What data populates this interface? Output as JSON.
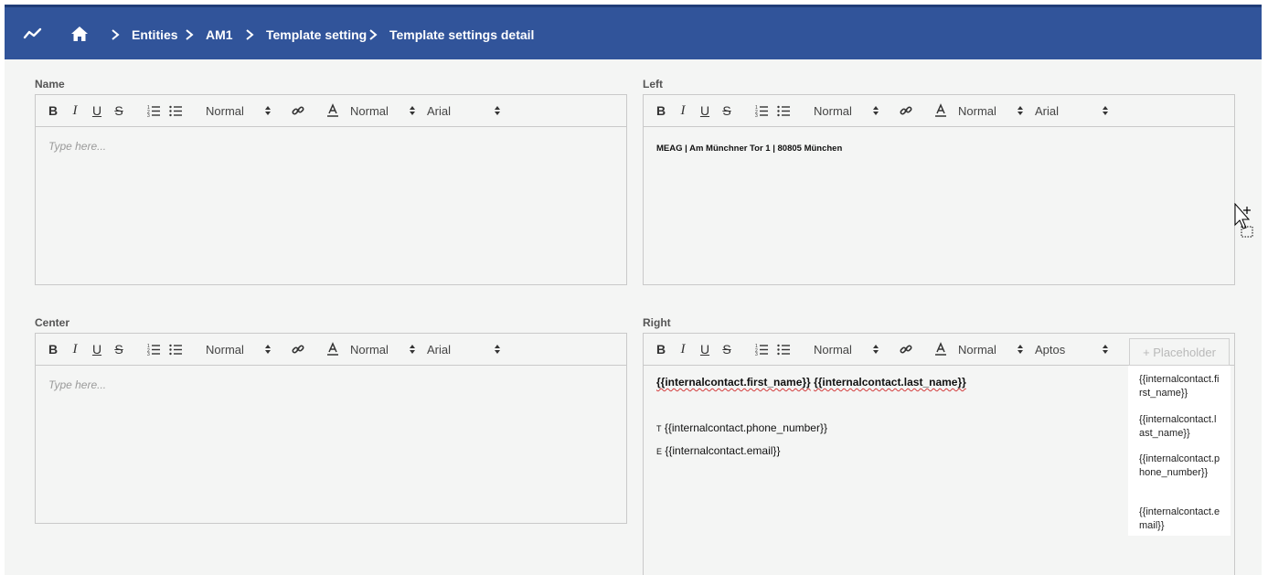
{
  "breadcrumb": {
    "items": [
      "Entities",
      "AM1",
      "Template setting",
      "Template settings detail"
    ]
  },
  "toolbar": {
    "bold": "B",
    "italic": "I",
    "underline": "U",
    "strike": "S",
    "size_label": "Normal",
    "style_label": "Normal",
    "font_default": "Arial",
    "font_right": "Aptos"
  },
  "fields": {
    "name": {
      "label": "Name",
      "placeholder": "Type here..."
    },
    "left": {
      "label": "Left",
      "content": "MEAG | Am Münchner Tor 1 | 80805 München"
    },
    "center": {
      "label": "Center",
      "placeholder": "Type here..."
    },
    "right": {
      "label": "Right",
      "first_name": "{{internalcontact.first_name}}",
      "last_name": "{{internalcontact.last_name}}",
      "phone_prefix": "T",
      "phone": "{{internalcontact.phone_number}}",
      "email_prefix": "E",
      "email": "{{internalcontact.email}}"
    }
  },
  "placeholder_menu": {
    "button_label": "+ Placeholder",
    "items": [
      "{{internalcontact.first_name}}",
      "{{internalcontact.last_name}}",
      "{{internalcontact.phone_number}}",
      "{{internalcontact.email}}"
    ]
  },
  "colors": {
    "header": "#31549a",
    "background": "#f4f5f4",
    "border": "#c9c9c9"
  }
}
